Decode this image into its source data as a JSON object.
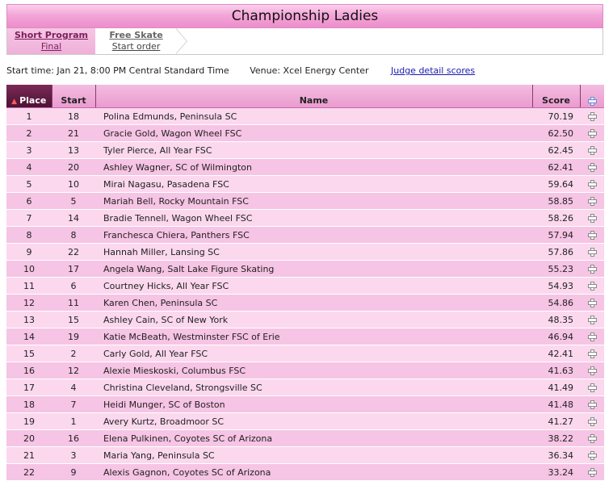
{
  "title": "Championship Ladies",
  "tabs": [
    {
      "label": "Short Program",
      "sub": "Final"
    },
    {
      "label": "Free Skate",
      "sub": "Start order"
    }
  ],
  "info": {
    "start_time": "Start time: Jan 21, 8:00 PM Central Standard Time",
    "venue": "Venue: Xcel Energy Center",
    "judge_link": "Judge detail scores"
  },
  "table": {
    "headers": {
      "place": "Place",
      "start": "Start",
      "name": "Name",
      "score": "Score"
    },
    "rows": [
      {
        "place": "1",
        "start": "18",
        "name": "Polina Edmunds, Peninsula SC",
        "score": "70.19"
      },
      {
        "place": "2",
        "start": "21",
        "name": "Gracie Gold, Wagon Wheel FSC",
        "score": "62.50"
      },
      {
        "place": "3",
        "start": "13",
        "name": "Tyler Pierce, All Year FSC",
        "score": "62.45"
      },
      {
        "place": "4",
        "start": "20",
        "name": "Ashley Wagner, SC of Wilmington",
        "score": "62.41"
      },
      {
        "place": "5",
        "start": "10",
        "name": "Mirai Nagasu, Pasadena FSC",
        "score": "59.64"
      },
      {
        "place": "6",
        "start": "5",
        "name": "Mariah Bell, Rocky Mountain FSC",
        "score": "58.85"
      },
      {
        "place": "7",
        "start": "14",
        "name": "Bradie Tennell, Wagon Wheel FSC",
        "score": "58.26"
      },
      {
        "place": "8",
        "start": "8",
        "name": "Franchesca Chiera, Panthers FSC",
        "score": "57.94"
      },
      {
        "place": "9",
        "start": "22",
        "name": "Hannah Miller, Lansing SC",
        "score": "57.86"
      },
      {
        "place": "10",
        "start": "17",
        "name": "Angela Wang, Salt Lake Figure Skating",
        "score": "55.23"
      },
      {
        "place": "11",
        "start": "6",
        "name": "Courtney Hicks, All Year FSC",
        "score": "54.93"
      },
      {
        "place": "12",
        "start": "11",
        "name": "Karen Chen, Peninsula SC",
        "score": "54.86"
      },
      {
        "place": "13",
        "start": "15",
        "name": "Ashley Cain, SC of New York",
        "score": "48.35"
      },
      {
        "place": "14",
        "start": "19",
        "name": "Katie McBeath, Westminster FSC of Erie",
        "score": "46.94"
      },
      {
        "place": "15",
        "start": "2",
        "name": "Carly Gold, All Year FSC",
        "score": "42.41"
      },
      {
        "place": "16",
        "start": "12",
        "name": "Alexie Mieskoski, Columbus FSC",
        "score": "41.63"
      },
      {
        "place": "17",
        "start": "4",
        "name": "Christina Cleveland, Strongsville SC",
        "score": "41.49"
      },
      {
        "place": "18",
        "start": "7",
        "name": "Heidi Munger, SC of Boston",
        "score": "41.48"
      },
      {
        "place": "19",
        "start": "1",
        "name": "Avery Kurtz, Broadmoor SC",
        "score": "41.27"
      },
      {
        "place": "20",
        "start": "16",
        "name": "Elena Pulkinen, Coyotes SC of Arizona",
        "score": "38.22"
      },
      {
        "place": "21",
        "start": "3",
        "name": "Maria Yang, Peninsula SC",
        "score": "36.34"
      },
      {
        "place": "22",
        "start": "9",
        "name": "Alexis Gagnon, Coyotes SC of Arizona",
        "score": "33.24"
      }
    ]
  },
  "colors": {
    "header_pink": "#ec8ecb",
    "row_light": "#fbd8ee",
    "row_dark": "#f6c4e4",
    "place_header": "#4e1234"
  }
}
